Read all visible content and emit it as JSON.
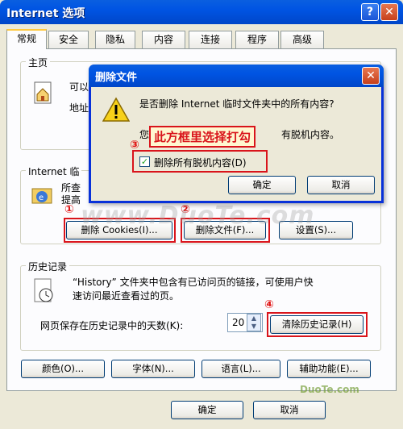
{
  "window": {
    "title": "Internet 选项",
    "help_glyph": "?",
    "close_glyph": "✕"
  },
  "tabs": [
    {
      "label": "常规"
    },
    {
      "label": "安全"
    },
    {
      "label": "隐私"
    },
    {
      "label": "内容"
    },
    {
      "label": "连接"
    },
    {
      "label": "程序"
    },
    {
      "label": "高级"
    }
  ],
  "homepage": {
    "group_label": "主页",
    "text1": "可以",
    "text2": "地址"
  },
  "temp_files": {
    "group_label": "Internet 临",
    "text1": "所查",
    "text2": "提高",
    "delete_cookies_button": "删除 Cookies(I)...",
    "delete_files_button": "删除文件(F)...",
    "settings_button": "设置(S)..."
  },
  "history": {
    "group_label": "历史记录",
    "description_line1": "“History” 文件夹中包含有已访问页的链接，可使用户快",
    "description_line2": "速访问最近查看过的页。",
    "days_label": "网页保存在历史记录中的天数(K):",
    "days_value": "20",
    "clear_button": "清除历史记录(H)"
  },
  "bottom_buttons": {
    "colors": "颜色(O)...",
    "fonts": "字体(N)...",
    "languages": "语言(L)...",
    "accessibility": "辅助功能(E)..."
  },
  "footer": {
    "ok": "确定",
    "cancel": "取消"
  },
  "dialog": {
    "title": "删除文件",
    "question": "是否删除 Internet 临时文件夹中的所有内容?",
    "line2_prefix": "您",
    "line2_suffix": "有脱机内容。",
    "checkbox_label": "删除所有脱机内容(D)",
    "ok": "确定",
    "cancel": "取消",
    "close_glyph": "✕"
  },
  "annotations": {
    "callout": "此方框里选择打勾",
    "n1": "①",
    "n2": "②",
    "n3": "③",
    "n4": "④"
  },
  "watermarks": {
    "center": "www.DuoTe.com",
    "corner": "DuoTe.com"
  },
  "colors": {
    "titlebar": "#0054e3",
    "highlight_red": "#d9141b",
    "face": "#ece9d8"
  }
}
